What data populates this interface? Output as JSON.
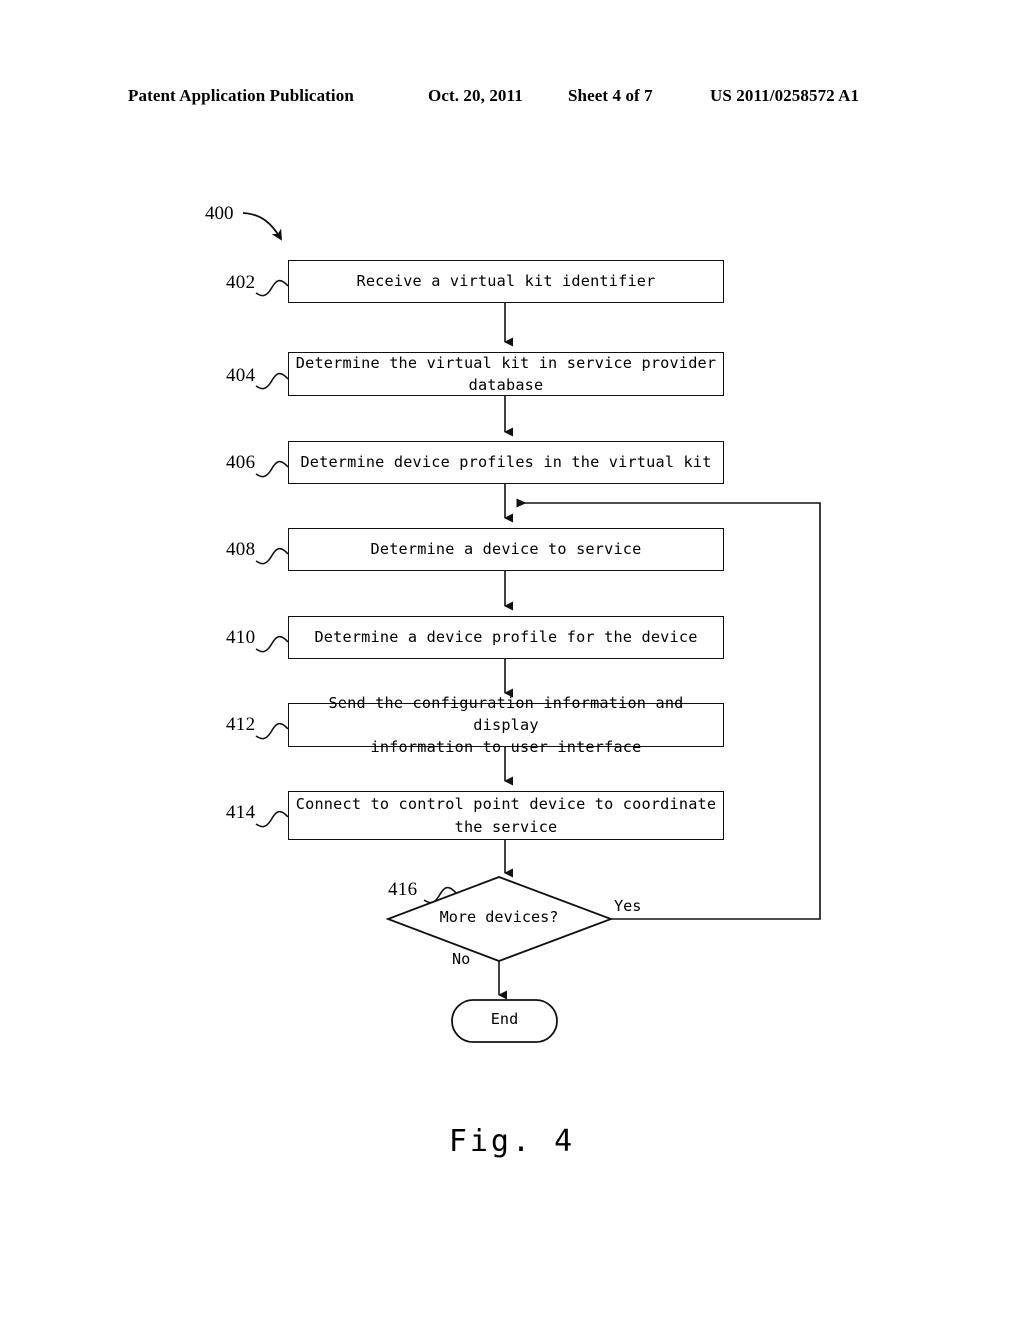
{
  "header": {
    "publication": "Patent Application Publication",
    "date": "Oct. 20, 2011",
    "sheet": "Sheet 4 of 7",
    "patent_number": "US 2011/0258572 A1"
  },
  "figure": {
    "caption": "Fig. 4",
    "figure_id": "400",
    "type": "flowchart"
  },
  "flowchart": {
    "steps": [
      {
        "ref": "402",
        "text": "Receive a virtual kit identifier",
        "shape": "process"
      },
      {
        "ref": "404",
        "text": "Determine the virtual kit in service provider\ndatabase",
        "shape": "process"
      },
      {
        "ref": "406",
        "text": "Determine device profiles in the virtual kit",
        "shape": "process"
      },
      {
        "ref": "408",
        "text": "Determine a device to service",
        "shape": "process"
      },
      {
        "ref": "410",
        "text": "Determine a device profile for the device",
        "shape": "process"
      },
      {
        "ref": "412",
        "text": "Send the configuration information and display\ninformation to user interface",
        "shape": "process"
      },
      {
        "ref": "414",
        "text": "Connect to control point device to coordinate\nthe service",
        "shape": "process"
      }
    ],
    "decision": {
      "ref": "416",
      "text": "More devices?",
      "shape": "decision",
      "yes_label": "Yes",
      "no_label": "No"
    },
    "terminal": {
      "text": "End",
      "shape": "terminal"
    }
  },
  "colors": {
    "ink": "#111111",
    "paper": "#ffffff"
  }
}
